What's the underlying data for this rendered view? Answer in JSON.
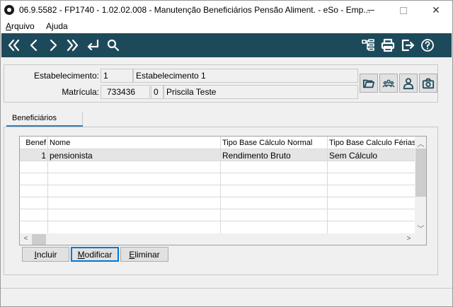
{
  "window": {
    "title": "06.9.5582 - FP1740 - 1.02.02.008 - Manutenção Beneficiários Pensão Aliment. - eSo - Emp...",
    "minimize": "—",
    "maximize": "☐",
    "close": "✕"
  },
  "menu": {
    "arquivo": {
      "first": "A",
      "rest": "rquivo"
    },
    "ajuda": {
      "first": "A",
      "pre": "A",
      "ul": "j",
      "post": "uda"
    }
  },
  "toolbar": {
    "icons": [
      "first-record-icon",
      "previous-record-icon",
      "next-record-icon",
      "last-record-icon",
      "return-icon",
      "search-icon",
      "tree-structure-icon",
      "print-icon",
      "exit-icon",
      "help-icon"
    ],
    "background": "#1d4a5a"
  },
  "header": {
    "estabelecimento_label": "Estabelecimento:",
    "estabelecimento_code": "1",
    "estabelecimento_name": "Estabelecimento 1",
    "matricula_label": "Matrícula:",
    "matricula_value": "733436",
    "matricula_digit": "0",
    "matricula_name": "Priscila Teste",
    "side_icons": [
      "folder-icon",
      "people-group-icon",
      "person-icon",
      "camera-icon"
    ]
  },
  "tabs": {
    "beneficiarios": "Beneficiários"
  },
  "grid": {
    "columns": [
      "Benef",
      "Nome",
      "Tipo Base Cálculo Normal",
      "Tipo Base Calculo Férias"
    ],
    "rows": [
      [
        "1",
        "pensionista",
        "Rendimento Bruto",
        "Sem Cálculo"
      ]
    ],
    "empty_rows": 6
  },
  "buttons": {
    "incluir": {
      "ul": "I",
      "rest": "ncluir"
    },
    "modificar": {
      "ul": "M",
      "rest": "odificar"
    },
    "eliminar": {
      "ul": "E",
      "rest": "liminar"
    }
  },
  "colors": {
    "accent": "#2d7fbf",
    "toolbar": "#1d4a5a",
    "selection": "#e5e5e5"
  }
}
